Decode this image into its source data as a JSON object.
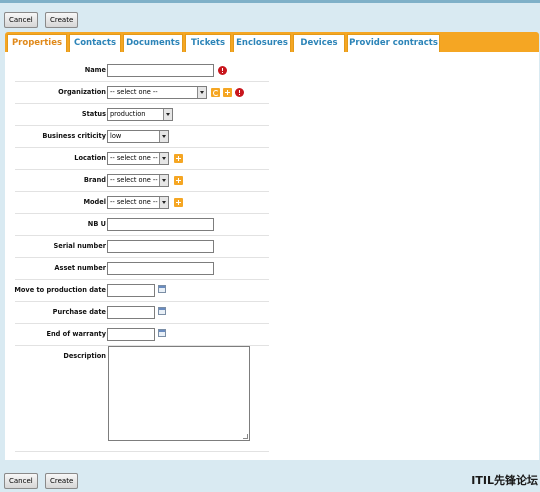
{
  "toolbar_top": {
    "cancel_label": "Cancel",
    "create_label": "Create"
  },
  "toolbar_bottom": {
    "cancel_label": "Cancel",
    "create_label": "Create"
  },
  "tabs": [
    {
      "label": "Properties",
      "active": true
    },
    {
      "label": "Contacts"
    },
    {
      "label": "Documents"
    },
    {
      "label": "Tickets"
    },
    {
      "label": "Enclosures"
    },
    {
      "label": "Devices"
    },
    {
      "label": "Provider contracts"
    }
  ],
  "form": {
    "name": {
      "label": "Name",
      "value": ""
    },
    "organization": {
      "label": "Organization",
      "value": "-- select one --"
    },
    "status": {
      "label": "Status",
      "value": "production"
    },
    "business_criticity": {
      "label": "Business criticity",
      "value": "low"
    },
    "location": {
      "label": "Location",
      "value": "-- select one --"
    },
    "brand": {
      "label": "Brand",
      "value": "-- select one --"
    },
    "model": {
      "label": "Model",
      "value": "-- select one --"
    },
    "nb_u": {
      "label": "NB U",
      "value": ""
    },
    "serial_number": {
      "label": "Serial number",
      "value": ""
    },
    "asset_number": {
      "label": "Asset number",
      "value": ""
    },
    "move_to_production_date": {
      "label": "Move to production date",
      "value": ""
    },
    "purchase_date": {
      "label": "Purchase date",
      "value": ""
    },
    "end_of_warranty": {
      "label": "End of warranty",
      "value": ""
    },
    "description": {
      "label": "Description",
      "value": ""
    }
  },
  "watermark": "ITIL先锋论坛",
  "colors": {
    "accent": "#f5a623",
    "tab_text": "#2c84b8",
    "active_tab_text": "#e0891a",
    "background": "#d9eaf2",
    "error": "#c8161d"
  }
}
